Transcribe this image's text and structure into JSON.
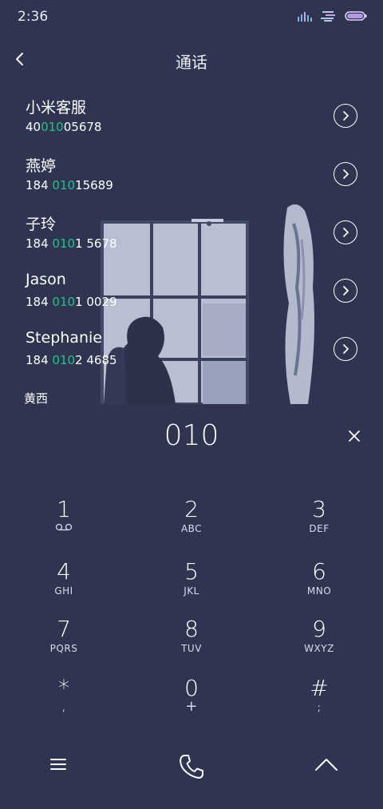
{
  "status_bar": {
    "time": "2:36",
    "icons": [
      "signal-bars-icon",
      "network-icon",
      "battery-icon"
    ]
  },
  "header": {
    "title": "通话",
    "back_icon": "chevron-left-icon"
  },
  "contacts": [
    {
      "name": "小米客服",
      "number_pre": "40",
      "number_match": "010",
      "number_post": "05678"
    },
    {
      "name": "燕婷",
      "number_pre": "184 ",
      "number_match": "010",
      "number_post": "15689"
    },
    {
      "name": "子玲",
      "number_pre": "184 ",
      "number_match": "010",
      "number_post": "1 5678"
    },
    {
      "name": "Jason",
      "number_pre": "184 ",
      "number_match": "010",
      "number_post": "1 0029"
    },
    {
      "name": "Stephanie",
      "number_pre": "184 ",
      "number_match": "010",
      "number_post": "2 4685"
    }
  ],
  "partial_contact": "黄西",
  "dialed_number": "010",
  "keypad": [
    {
      "digit": "1",
      "letters": "",
      "icon": "voicemail-icon"
    },
    {
      "digit": "2",
      "letters": "ABC"
    },
    {
      "digit": "3",
      "letters": "DEF"
    },
    {
      "digit": "4",
      "letters": "GHI"
    },
    {
      "digit": "5",
      "letters": "JKL"
    },
    {
      "digit": "6",
      "letters": "MNO"
    },
    {
      "digit": "7",
      "letters": "PQRS"
    },
    {
      "digit": "8",
      "letters": "TUV"
    },
    {
      "digit": "9",
      "letters": "WXYZ"
    },
    {
      "digit": "*",
      "letters": ","
    },
    {
      "digit": "0",
      "letters": "+"
    },
    {
      "digit": "#",
      "letters": ";"
    }
  ],
  "colors": {
    "background": "#2f3550",
    "match_highlight": "#28c08a",
    "photo_tint": "#b9bfd3"
  },
  "bottom_bar": {
    "menu_icon": "menu-icon",
    "call_icon": "phone-icon",
    "collapse_icon": "chevron-up-icon"
  }
}
